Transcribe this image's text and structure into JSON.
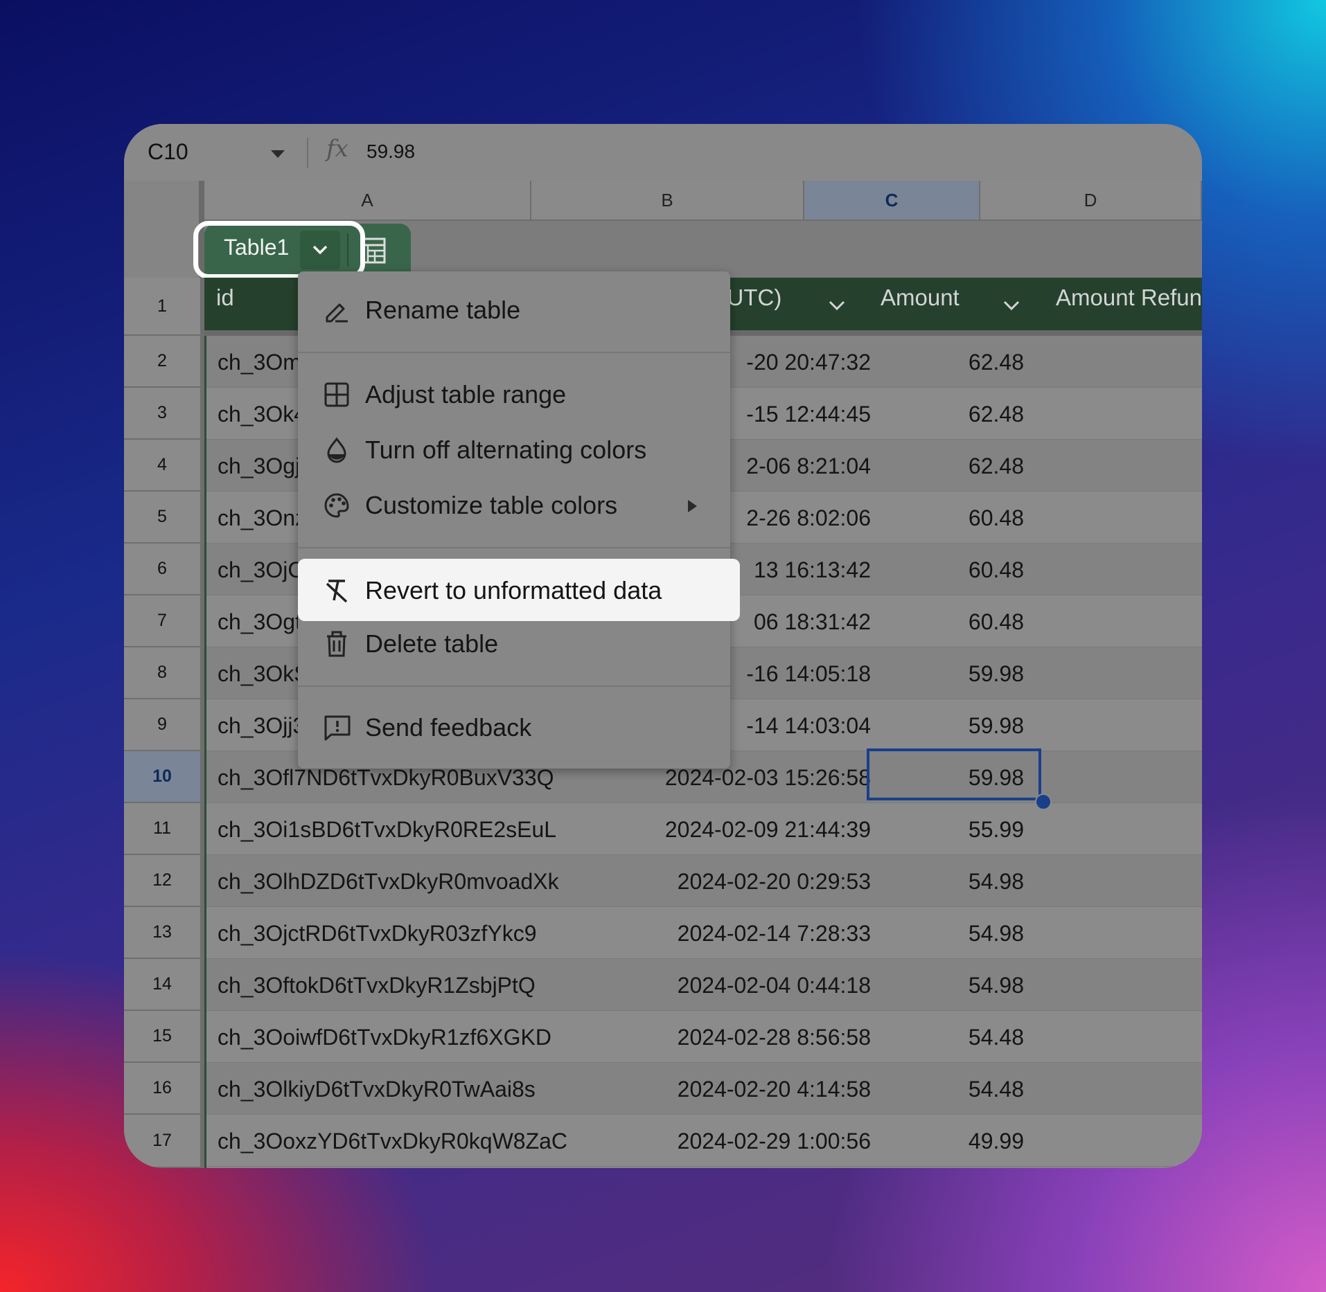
{
  "formula_bar": {
    "name_box": "C10",
    "fx_icon": "fx-icon",
    "value": "59.98"
  },
  "columns": [
    "A",
    "B",
    "C",
    "D"
  ],
  "table": {
    "name": "Table1",
    "headers": [
      "id",
      "e (UTC)",
      "Amount",
      "Amount Refun"
    ]
  },
  "menu": {
    "items": [
      {
        "label": "Rename table",
        "icon": "rename-icon"
      },
      {
        "label": "Adjust table range",
        "icon": "table-grid-icon"
      },
      {
        "label": "Turn off alternating colors",
        "icon": "color-drop-icon"
      },
      {
        "label": "Customize table colors",
        "icon": "palette-icon"
      },
      {
        "label": "Revert to unformatted data",
        "icon": "clear-format-icon"
      },
      {
        "label": "Delete table",
        "icon": "trash-icon"
      },
      {
        "label": "Send feedback",
        "icon": "feedback-icon"
      }
    ]
  },
  "row_numbers": [
    "1",
    "2",
    "3",
    "4",
    "5",
    "6",
    "7",
    "8",
    "9",
    "10",
    "11",
    "12",
    "13",
    "14",
    "15",
    "16",
    "17"
  ],
  "rows": [
    {
      "a": "ch_3Om",
      "b": "-20 20:47:32",
      "c": "62.48"
    },
    {
      "a": "ch_3Ok4",
      "b": "-15 12:44:45",
      "c": "62.48"
    },
    {
      "a": "ch_3Ogj",
      "b": "2-06 8:21:04",
      "c": "62.48"
    },
    {
      "a": "ch_3Onz",
      "b": "2-26 8:02:06",
      "c": "60.48"
    },
    {
      "a": "ch_3OjC",
      "b": "13 16:13:42",
      "c": "60.48"
    },
    {
      "a": "ch_3Ogt",
      "b": "06 18:31:42",
      "c": "60.48"
    },
    {
      "a": "ch_3OkS",
      "b": "-16 14:05:18",
      "c": "59.98"
    },
    {
      "a": "ch_3Ojj3",
      "b": "-14 14:03:04",
      "c": "59.98"
    },
    {
      "a": "ch_3Ofl7ND6tTvxDkyR0BuxV33Q",
      "b": "2024-02-03 15:26:58",
      "c": "59.98"
    },
    {
      "a": "ch_3Oi1sBD6tTvxDkyR0RE2sEuL",
      "b": "2024-02-09 21:44:39",
      "c": "55.99"
    },
    {
      "a": "ch_3OlhDZD6tTvxDkyR0mvoadXk",
      "b": "2024-02-20 0:29:53",
      "c": "54.98"
    },
    {
      "a": "ch_3OjctRD6tTvxDkyR03zfYkc9",
      "b": "2024-02-14 7:28:33",
      "c": "54.98"
    },
    {
      "a": "ch_3OftokD6tTvxDkyR1ZsbjPtQ",
      "b": "2024-02-04 0:44:18",
      "c": "54.98"
    },
    {
      "a": "ch_3OoiwfD6tTvxDkyR1zf6XGKD",
      "b": "2024-02-28 8:56:58",
      "c": "54.48"
    },
    {
      "a": "ch_3OlkiyD6tTvxDkyR0TwAai8s",
      "b": "2024-02-20 4:14:58",
      "c": "54.48"
    },
    {
      "a": "ch_3OoxzYD6tTvxDkyR0kqW8ZaC",
      "b": "2024-02-29 1:00:56",
      "c": "49.99"
    }
  ]
}
